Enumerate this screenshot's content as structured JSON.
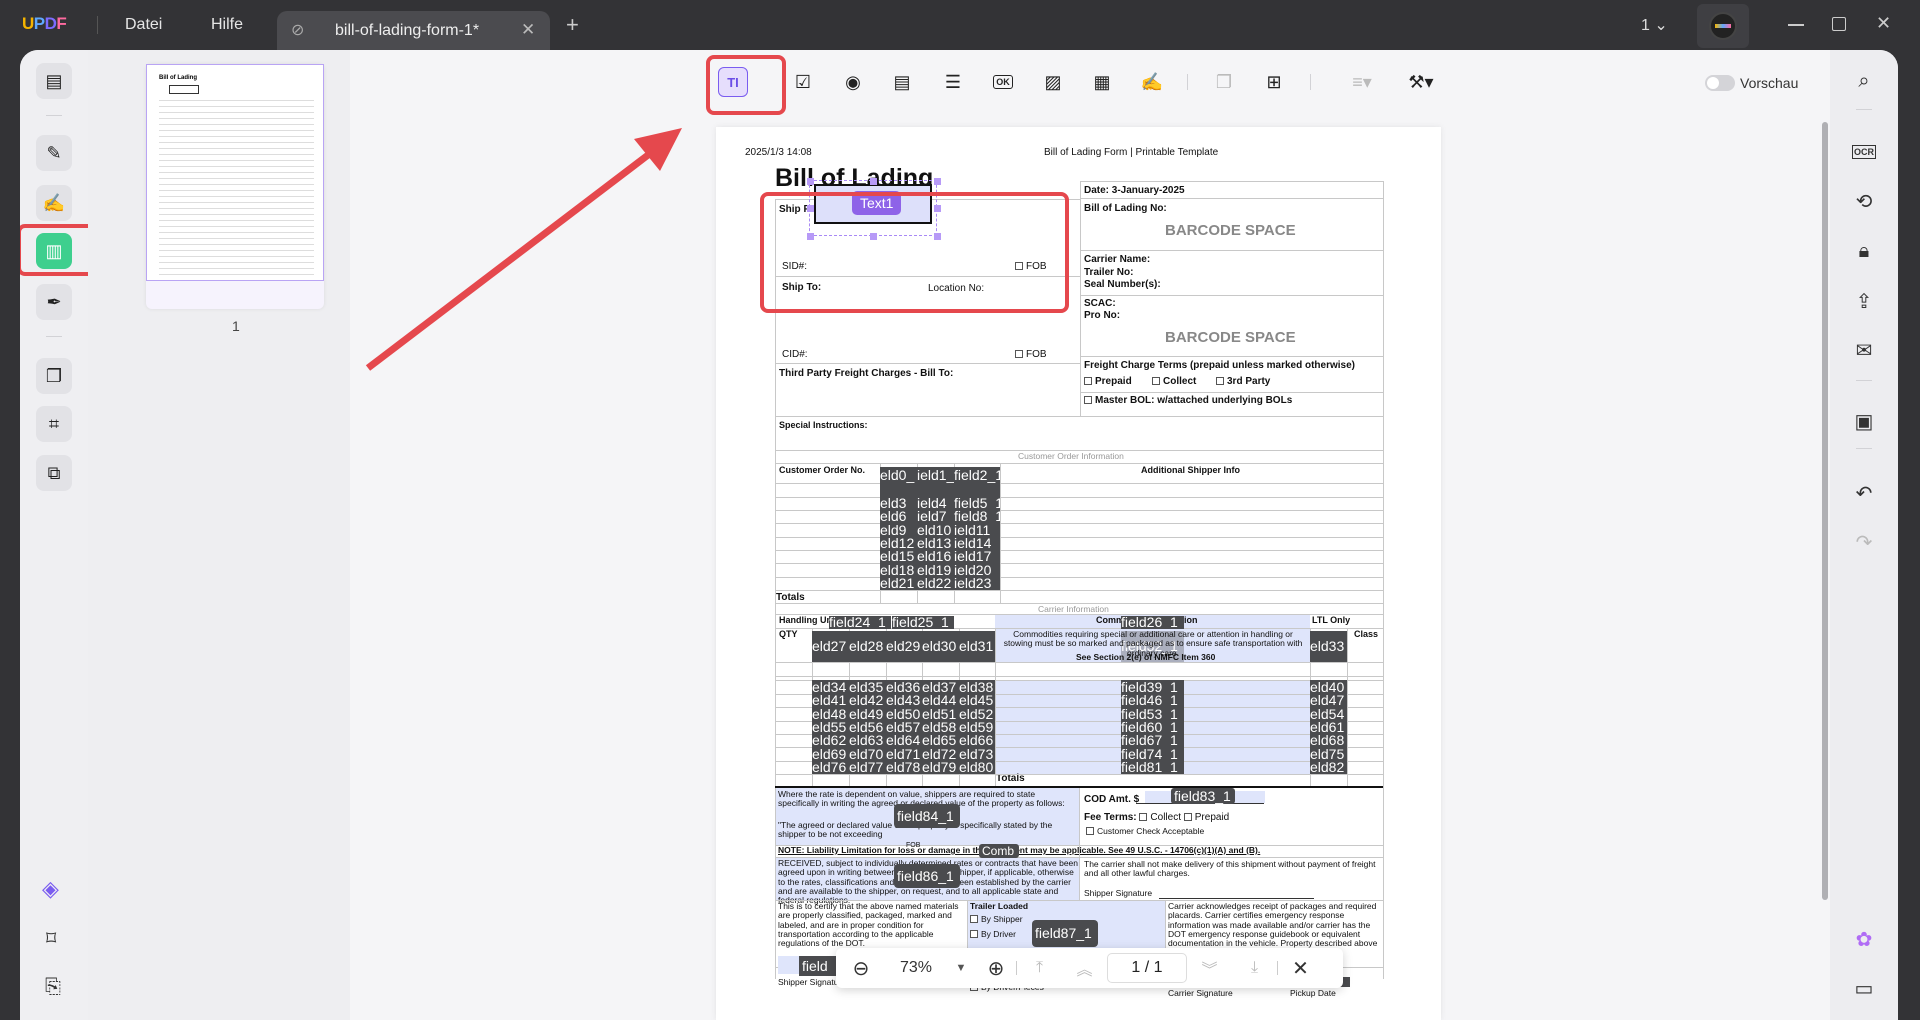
{
  "titlebar": {
    "logo": "UPDF",
    "menu": [
      "Datei",
      "Hilfe"
    ],
    "tab_title": "bill-of-lading-form-1*",
    "new_tab": "+",
    "page_indicator": "1",
    "window_buttons": [
      "minimize-icon",
      "maximize-icon",
      "close-icon"
    ]
  },
  "toolbar": {
    "tools": [
      "text-field-icon",
      "checkbox-icon",
      "radio-button-icon",
      "dropdown-icon",
      "list-box-icon",
      "button-icon",
      "image-icon",
      "date-icon",
      "signature-icon",
      "duplicate-icon",
      "grid-icon",
      "align-icon",
      "tools-icon"
    ],
    "text_field_glyph": "TI",
    "button_glyph": "OK",
    "preview_label": "Vorschau",
    "preview_on": false
  },
  "left_rail": {
    "items": [
      "reader-icon",
      "highlighter-icon",
      "edit-icon",
      "form-icon",
      "sign-icon",
      "organize-icon",
      "crop-icon",
      "convert-icon"
    ],
    "bottom": [
      "layers-icon",
      "bookmark-icon",
      "attachment-icon"
    ],
    "active": "form-icon"
  },
  "right_rail": {
    "items": [
      "search-icon",
      "ocr-icon",
      "convert-icon",
      "protect-icon",
      "share-icon",
      "email-icon",
      "save-icon",
      "undo-icon",
      "redo-icon"
    ],
    "bottom": [
      "ai-assistant-icon",
      "comment-icon"
    ],
    "ocr_label": "OCR"
  },
  "thumbnail": {
    "page_number": "1"
  },
  "form": {
    "timestamp": "2025/1/3 14:08",
    "header": "Bill of Lading Form | Printable Template",
    "title": "Bill of Lading",
    "ship_from": "Ship From:",
    "sid": "SID#:",
    "fob": "FOB",
    "ship_to": "Ship To:",
    "location_no": "Location No:",
    "cid": "CID#:",
    "third_party": "Third Party Freight Charges - Bill To:",
    "special": "Special Instructions:",
    "date": "Date: 3-January-2025",
    "bol_no": "Bill of Lading No:",
    "barcode": "BARCODE SPACE",
    "carrier_name": "Carrier Name:",
    "trailer_no": "Trailer No:",
    "seal": "Seal Number(s):",
    "scac": "SCAC:",
    "pro_no": "Pro No:",
    "freight_terms": "Freight Charge Terms (prepaid unless marked otherwise)",
    "prepaid": "Prepaid",
    "collect": "Collect",
    "third_party_opt": "3rd Party",
    "master_bol": "Master BOL: w/attached underlying BOLs",
    "customer_order_info": "Customer Order Information",
    "customer_order_no": "Customer Order No.",
    "additional_shipper_info": "Additional Shipper Info",
    "totals": "Totals",
    "carrier_info": "Carrier Information",
    "handling_unit": "Handling Unit",
    "commodity_description": "Commodity Description",
    "ltl_only": "LTL Only",
    "qty": "QTY",
    "class": "Class",
    "commodity_note": "Commodities requiring special or additional care or attention in handling or stowing must be so marked and packaged as to ensure safe transportation with ordinary care.",
    "see_section": "See Section 2(e) of NMFC Item 360",
    "rate_text": "Where the rate is dependent on value, shippers are required to state specifically in writing the agreed or declared value of the property as follows:",
    "declared_text": "\"The agreed or declared value of the property is specifically stated by the shipper to be not exceeding",
    "cod": "COD Amt. $",
    "fee_terms": "Fee Terms:",
    "fee_collect": "Collect",
    "fee_prepaid": "Prepaid",
    "customer_check": "Customer Check Acceptable",
    "note": "NOTE: Liability Limitation for loss or damage in this shipment may be applicable. See 49 U.S.C. - 14706(c)(1)(A) and (B).",
    "received": "RECEIVED, subject to individually determined rates or contracts that have been agreed upon in writing between the carrier and shipper, if applicable, otherwise to the rates, classifications and rules that have been established by the carrier and are available to the shipper, on request, and to all applicable state and federal regulations.",
    "carrier_shall_not": "The carrier shall not make delivery of this shipment without payment of freight and all other lawful charges.",
    "shipper_signature": "Shipper Signature",
    "certify": "This is to certify that the above named materials are properly classified, packaged, marked and labeled, and are in proper condition for transportation according to the applicable regulations of the DOT.",
    "trailer_loaded": "Trailer Loaded",
    "by_shipper": "By Shipper",
    "by_driver": "By Driver",
    "by_driver_pieces": "By Driver/Pieces",
    "carrier_ack": "Carrier acknowledges receipt of packages and required placards. Carrier certifies emergency response information was made available and/or carrier has the DOT emergency response guidebook or equivalent documentation in the vehicle. Property described above is received in good order",
    "shipper_sig_bottom": "Shipper Signature",
    "carrier_signature": "Carrier Signature",
    "pickup_date": "Pickup Date",
    "fob_small": "FOB"
  },
  "widget": {
    "label": "Text1"
  },
  "fields": {
    "customer_rows": [
      [
        "eld0_",
        "ield1_",
        "field2_1"
      ],
      [
        "",
        "",
        ""
      ],
      [
        "eld3",
        "ield4",
        "field5_1"
      ],
      [
        "eld6",
        "ield7",
        "field8_1"
      ],
      [
        "eld9",
        "eld10",
        "ield11"
      ],
      [
        "eld12",
        "eld13",
        "ield14"
      ],
      [
        "eld15_",
        "eld16_",
        "ield17_"
      ],
      [
        "eld18",
        "eld19",
        "ield20"
      ],
      [
        "eld21_",
        "eld22_",
        "ield23_"
      ]
    ],
    "handling": [
      "field24_1",
      "field25_1",
      "field26_1"
    ],
    "header_row": [
      "eld27",
      "eld28",
      "eld29",
      "eld30",
      "eld31",
      "field32_1",
      "eld33"
    ],
    "carrier_rows": [
      [
        "eld34",
        "eld35",
        "eld36",
        "eld37",
        "eld38",
        "field39_1",
        "eld40"
      ],
      [
        "eld41",
        "eld42",
        "eld43",
        "eld44",
        "eld45",
        "field46_1",
        "eld47"
      ],
      [
        "eld48",
        "eld49",
        "eld50",
        "eld51",
        "eld52",
        "field53_1",
        "eld54"
      ],
      [
        "eld55",
        "eld56",
        "eld57",
        "eld58",
        "eld59",
        "field60_1",
        "eld61"
      ],
      [
        "eld62",
        "eld63",
        "eld64",
        "eld65",
        "eld66",
        "field67_1",
        "eld68"
      ],
      [
        "eld69",
        "eld70",
        "eld71",
        "eld72",
        "eld73",
        "field74_1",
        "eld75"
      ],
      [
        "eld76",
        "eld77",
        "eld78",
        "eld79",
        "eld80",
        "field81_1",
        "eld82"
      ]
    ],
    "field83": "field83_1",
    "field84": "field84_1",
    "field86": "field86_1",
    "field87": "field87_1",
    "comb": "Comb",
    "field_bottom": "field"
  },
  "zoombar": {
    "zoom": "73%",
    "page": "1 / 1"
  }
}
